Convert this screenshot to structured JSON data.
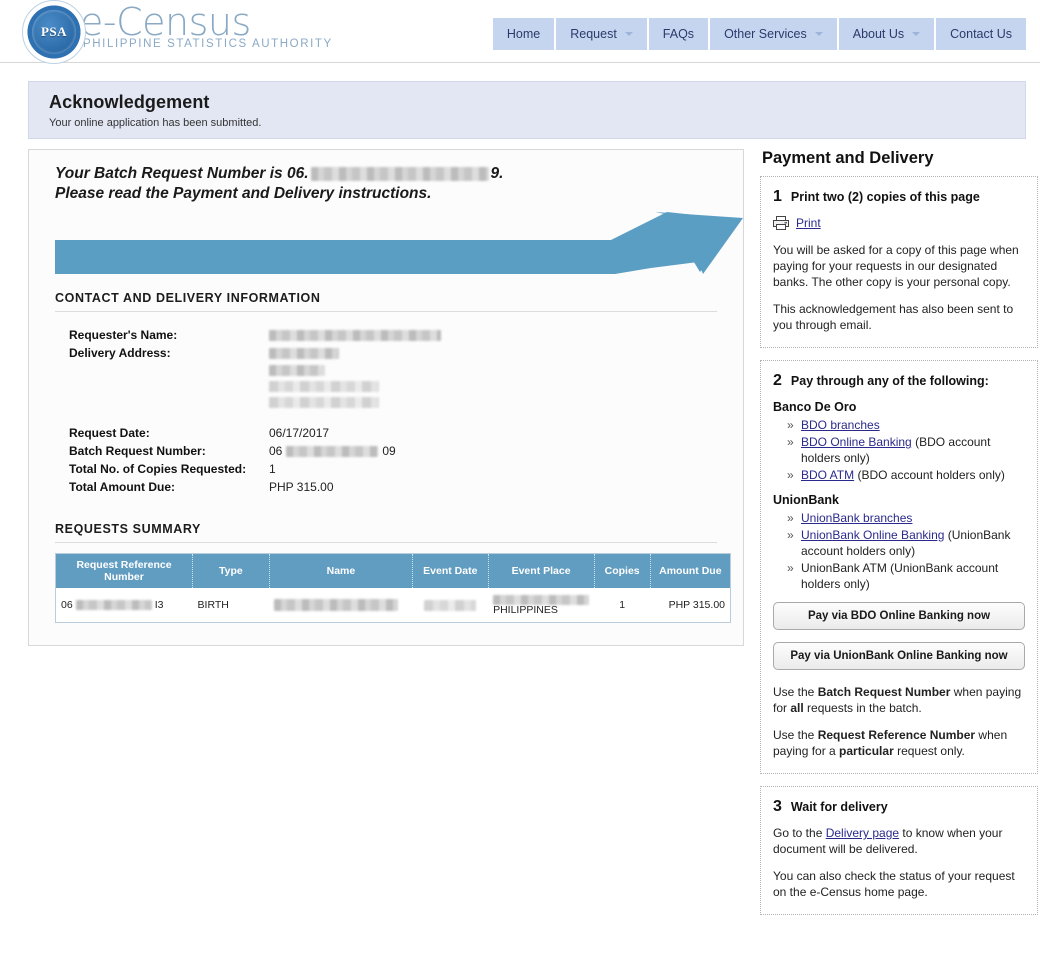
{
  "brand": {
    "seal_text": "PSA",
    "seal_ring_text": "PHILIPPINE STATISTICS AUTHORITY",
    "title": "e-Census",
    "subtitle": "PHILIPPINE STATISTICS AUTHORITY"
  },
  "nav": {
    "items": [
      {
        "label": "Home",
        "has_caret": false
      },
      {
        "label": "Request",
        "has_caret": true
      },
      {
        "label": "FAQs",
        "has_caret": false
      },
      {
        "label": "Other Services",
        "has_caret": true
      },
      {
        "label": "About Us",
        "has_caret": true
      },
      {
        "label": "Contact Us",
        "has_caret": false
      }
    ],
    "background": "#c5d5ef",
    "text_color": "#2b3a6b"
  },
  "acknowledgement": {
    "title": "Acknowledgement",
    "subtitle": "Your online application has been submitted."
  },
  "batch_headline": {
    "prefix": "Your Batch Request Number is 06.",
    "redacted": true,
    "suffix": "9.",
    "line2": "Please read the Payment and Delivery instructions.",
    "arrow_color": "#5b9ec4"
  },
  "contact_section": {
    "heading": "CONTACT AND DELIVERY INFORMATION",
    "rows": [
      {
        "label": "Requester's Name:",
        "value": "",
        "redacted": true
      },
      {
        "label": "Delivery Address:",
        "value": "",
        "redacted": true
      },
      {
        "label": "Request Date:",
        "value": "06/17/2017",
        "redacted": false
      },
      {
        "label": "Batch Request Number:",
        "value_prefix": "06",
        "value_suffix": "09",
        "redacted": true
      },
      {
        "label": "Total No. of Copies Requested:",
        "value": "1",
        "redacted": false
      },
      {
        "label": "Total Amount Due:",
        "value": "PHP 315.00",
        "redacted": false
      }
    ]
  },
  "requests_summary": {
    "heading": "REQUESTS SUMMARY",
    "columns": [
      "Request Reference Number",
      "Type",
      "Name",
      "Event Date",
      "Event Place",
      "Copies",
      "Amount Due"
    ],
    "rows": [
      {
        "reference_prefix": "06",
        "reference_suffix": "I3",
        "type": "BIRTH",
        "name": "",
        "event_date": "",
        "event_place": "PHILIPPINES",
        "copies": "1",
        "amount_due": "PHP 315.00"
      }
    ],
    "header_color": "#619cc1"
  },
  "payment_delivery": {
    "title": "Payment and Delivery",
    "step1": {
      "number": "1",
      "label": "Print two (2) copies of this page",
      "print_link": "Print",
      "para1": "You will be asked for a copy of this page when paying for your requests in our designated banks. The other copy is your personal copy.",
      "para2": "This acknowledgement has also been sent to you through email."
    },
    "step2": {
      "number": "2",
      "label": "Pay through any of the following:",
      "banks": [
        {
          "name": "Banco De Oro",
          "options": [
            {
              "link": "BDO branches",
              "note": ""
            },
            {
              "link": "BDO Online Banking",
              "note": " (BDO account holders only)"
            },
            {
              "link": "BDO ATM",
              "note": " (BDO account holders only)"
            }
          ]
        },
        {
          "name": "UnionBank",
          "options": [
            {
              "link": "UnionBank branches",
              "note": ""
            },
            {
              "link": "UnionBank Online Banking",
              "note": " (UnionBank account holders only)"
            },
            {
              "link": "",
              "note": "UnionBank ATM (UnionBank account holders only)"
            }
          ]
        }
      ],
      "bdo_button": "Pay via BDO Online Banking now",
      "unionbank_button": "Pay via UnionBank Online Banking now",
      "note1_a": "Use the ",
      "note1_b": "Batch Request Number",
      "note1_c": " when paying for ",
      "note1_d": "all",
      "note1_e": " requests in the batch.",
      "note2_a": "Use the ",
      "note2_b": "Request Reference Number",
      "note2_c": " when paying for a ",
      "note2_d": "particular",
      "note2_e": " request only."
    },
    "step3": {
      "number": "3",
      "label": "Wait for delivery",
      "para1_a": "Go to the ",
      "para1_link": "Delivery page",
      "para1_b": " to know when your document will be delivered.",
      "para2": "You can also check the status of your request on the e-Census home page."
    }
  }
}
